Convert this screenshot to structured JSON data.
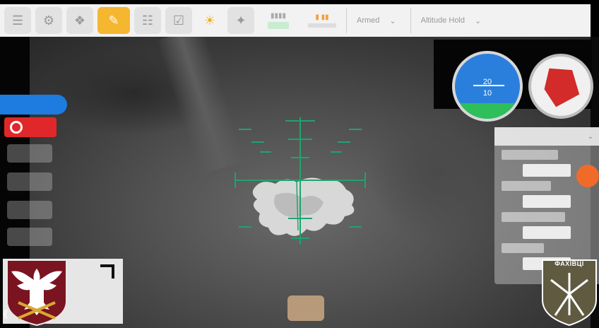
{
  "toolbar": {
    "mode_select": "Armed",
    "flight_mode": "Altitude Hold",
    "icons": [
      "menu-icon",
      "gear-icon",
      "vehicle-icon",
      "plan-icon",
      "document-icon",
      "checklist-icon",
      "sun-icon",
      "drone-icon",
      "signal-icon",
      "battery-icon"
    ]
  },
  "attitude": {
    "marks": [
      "20",
      "10"
    ]
  },
  "emblem": {
    "label": "ФАХІВЦІ"
  },
  "colors": {
    "reticle": "#1fa36f",
    "accent": "#f5b630",
    "mode_blue": "#1e7be0",
    "stop_red": "#e0282a"
  }
}
